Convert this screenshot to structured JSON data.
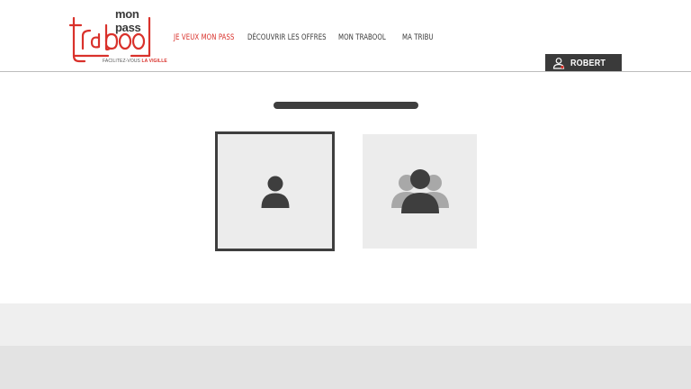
{
  "logo": {
    "top_text": "mon pass",
    "brand": "trabool",
    "tagline_prefix": "FACILITEZ-VOUS",
    "tagline_highlight": "LA VIGILLE"
  },
  "nav": {
    "items": [
      {
        "label": "JE VEUX MON PASS",
        "active": true
      },
      {
        "label": "DÉCOUVRIR LES OFFRES",
        "active": false
      },
      {
        "label": "MON TRABOOL",
        "active": false
      },
      {
        "label": "MA TRIBU",
        "active": false
      }
    ]
  },
  "user": {
    "name": "ROBERT",
    "icon": "user-icon"
  },
  "main": {
    "options": [
      {
        "icon": "single-person-icon",
        "selected": true
      },
      {
        "icon": "group-people-icon",
        "selected": false
      }
    ]
  },
  "colors": {
    "accent": "#d9312b",
    "dark": "#3a3a3a",
    "card_bg": "#ececec",
    "footer_light": "#efefef",
    "footer_dark": "#e3e3e3"
  }
}
